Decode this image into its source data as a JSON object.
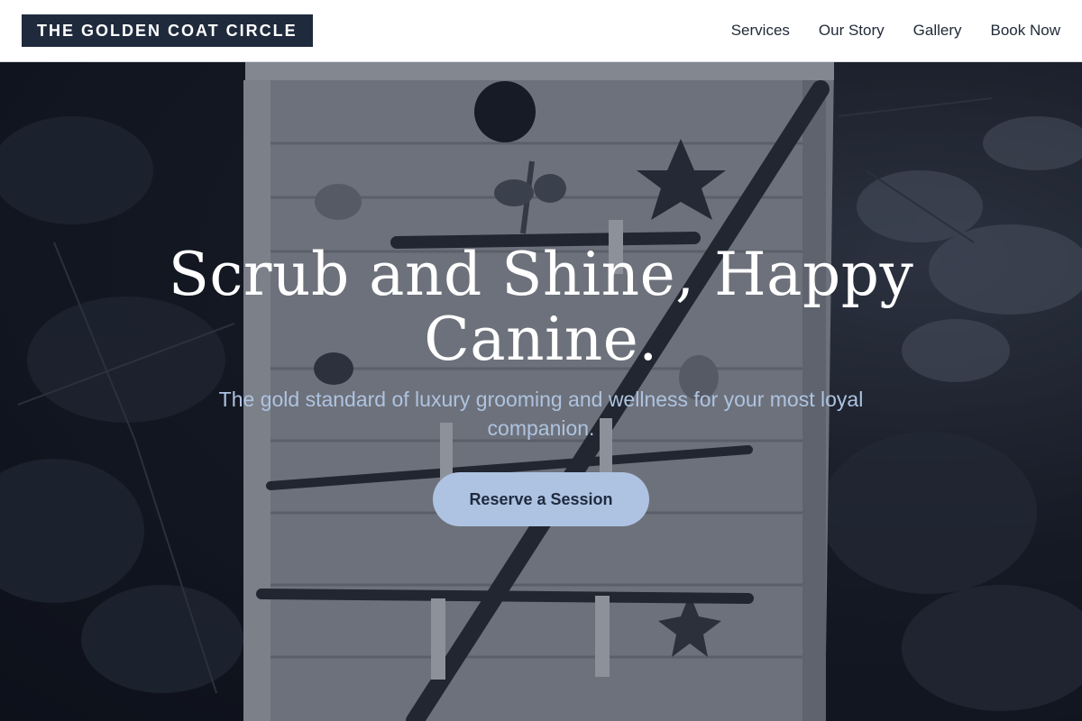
{
  "brand": {
    "name": "THE GOLDEN COAT CIRCLE"
  },
  "nav": {
    "items": [
      {
        "label": "Services"
      },
      {
        "label": "Our Story"
      },
      {
        "label": "Gallery"
      },
      {
        "label": "Book Now"
      }
    ]
  },
  "hero": {
    "title": "Scrub and Shine, Happy Canine.",
    "subtitle": "The gold standard of luxury grooming and wellness for your most loyal companion.",
    "cta_label": "Reserve a Session"
  },
  "colors": {
    "brand_dark": "#1f2a3d",
    "accent": "#aec3e2",
    "subtitle": "#aec3e0"
  }
}
